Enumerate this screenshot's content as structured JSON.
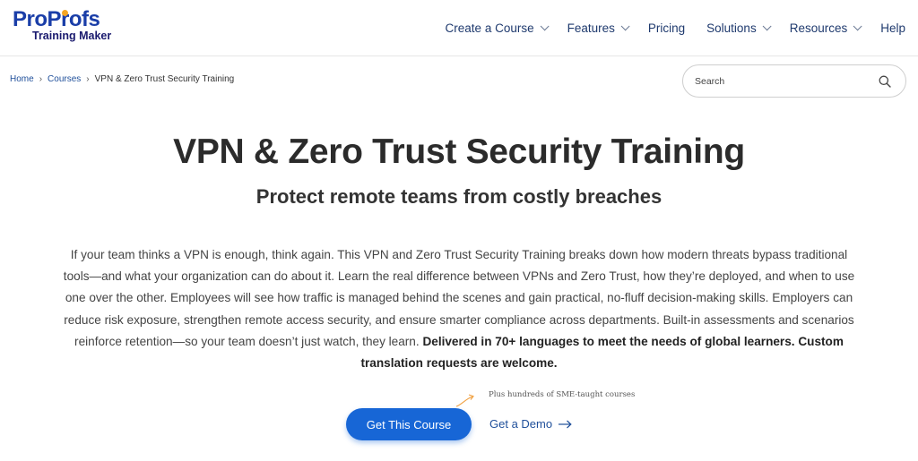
{
  "header": {
    "logo": {
      "main_part1": "Pro",
      "main_part2": "Profs",
      "sub": "Training Maker"
    },
    "nav": [
      {
        "label": "Create a Course",
        "has_dropdown": true
      },
      {
        "label": "Features",
        "has_dropdown": true
      },
      {
        "label": "Pricing",
        "has_dropdown": false
      },
      {
        "label": "Solutions",
        "has_dropdown": true
      },
      {
        "label": "Resources",
        "has_dropdown": true
      },
      {
        "label": "Help",
        "has_dropdown": false
      }
    ]
  },
  "breadcrumb": {
    "home": "Home",
    "courses": "Courses",
    "current": "VPN & Zero Trust Security Training",
    "separator": "›"
  },
  "search": {
    "placeholder": "Search",
    "icon": "search-icon"
  },
  "hero": {
    "title": "VPN & Zero Trust Security Training",
    "subtitle": "Protect remote teams from costly breaches",
    "description": "If your team thinks a VPN is enough, think again. This VPN and Zero Trust Security Training breaks down how modern threats bypass traditional tools—and what your organization can do about it. Learn the real difference between VPNs and Zero Trust, how they’re deployed, and when to use one over the other. Employees will see how traffic is managed behind the scenes and gain practical, no-fluff decision-making skills. Employers can reduce risk exposure, strengthen remote access security, and ensure smarter compliance across departments. Built-in assessments and scenarios reinforce retention—so your team doesn’t just watch, they learn.",
    "description_bold": "Delivered in 70+ languages to meet the needs of global learners. Custom translation requests are welcome."
  },
  "cta": {
    "primary_label": "Get This Course",
    "demo_label": "Get a Demo",
    "note": "Plus hundreds of SME-taught courses"
  },
  "colors": {
    "brand_blue": "#1a3ea8",
    "logo_accent": "#f5a623",
    "button_blue": "#1766d6",
    "nav_text": "#1f3a6e",
    "arrow_orange": "#f0a040"
  }
}
